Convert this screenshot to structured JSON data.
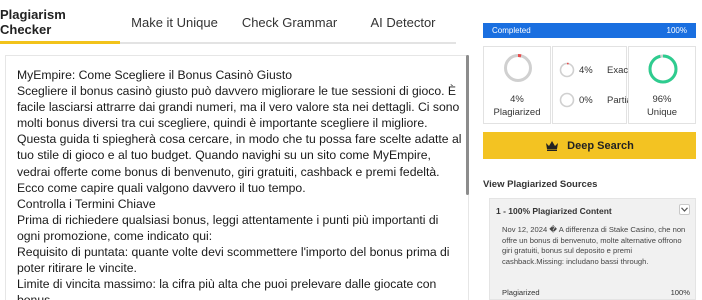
{
  "tabs": [
    {
      "label": "Plagiarism Checker",
      "active": true
    },
    {
      "label": "Make it Unique",
      "active": false
    },
    {
      "label": "Check Grammar",
      "active": false
    },
    {
      "label": "AI Detector",
      "active": false
    }
  ],
  "text": {
    "lines": [
      "MyEmpire: Come Scegliere il Bonus Casinò Giusto",
      "Scegliere il bonus casinò giusto può davvero migliorare le tue sessioni di gioco. È facile lasciarsi attrarre dai grandi numeri, ma il vero valore sta nei dettagli. Ci sono molti bonus diversi tra cui scegliere, quindi è importante scegliere il migliore.",
      "Questa guida ti spiegherà cosa cercare, in modo che tu possa fare scelte adatte al tuo stile di gioco e al tuo budget. Quando navighi su un sito come MyEmpire, vedrai offerte come bonus di benvenuto, giri gratuiti, cashback e premi fedeltà. Ecco come capire quali valgono davvero il tuo tempo.",
      "Controlla i Termini Chiave",
      "Prima di richiedere qualsiasi bonus, leggi attentamente i punti più importanti di ogni promozione, come indicato qui:",
      "Requisito di puntata: quante volte devi scommettere l'importo del bonus prima di poter ritirare le vincite.",
      "Limite di vincita massimo: la cifra più alta che puoi prelevare dalle giocate con bonus."
    ]
  },
  "progress": {
    "label": "Completed",
    "value_text": "100%",
    "value": 1.0,
    "color": "#1a6fe0"
  },
  "stats": {
    "plagiarized": {
      "value_text": "4%",
      "label": "Plagiarized",
      "value": 0.04
    },
    "exact": {
      "value_text": "4%",
      "label": "Exact",
      "value": 0.04
    },
    "partial": {
      "value_text": "0%",
      "label": "Partial",
      "value": 0.0
    },
    "unique": {
      "value_text": "96%",
      "label": "Unique",
      "value": 0.96
    }
  },
  "deep_search": {
    "label": "Deep Search",
    "icon": "crown-icon",
    "color": "#f3c322"
  },
  "sources": {
    "title": "View Plagiarized Sources",
    "items": [
      {
        "heading": "1 - 100% Plagiarized Content",
        "text": "Nov 12, 2024 � A differenza di Stake Casino, che non offre un bonus di benvenuto, molte alternative offrono giri gratuiti, bonus sul deposito e premi cashback.Missing: includano bassi through.",
        "footer_label": "Plagiarized",
        "footer_value": "100%"
      }
    ]
  },
  "colors": {
    "accent": "#f2c31b",
    "unique_green": "#2ecc8f",
    "plag_red": "#e84c4c",
    "ring_gray": "#d0d0d0"
  }
}
